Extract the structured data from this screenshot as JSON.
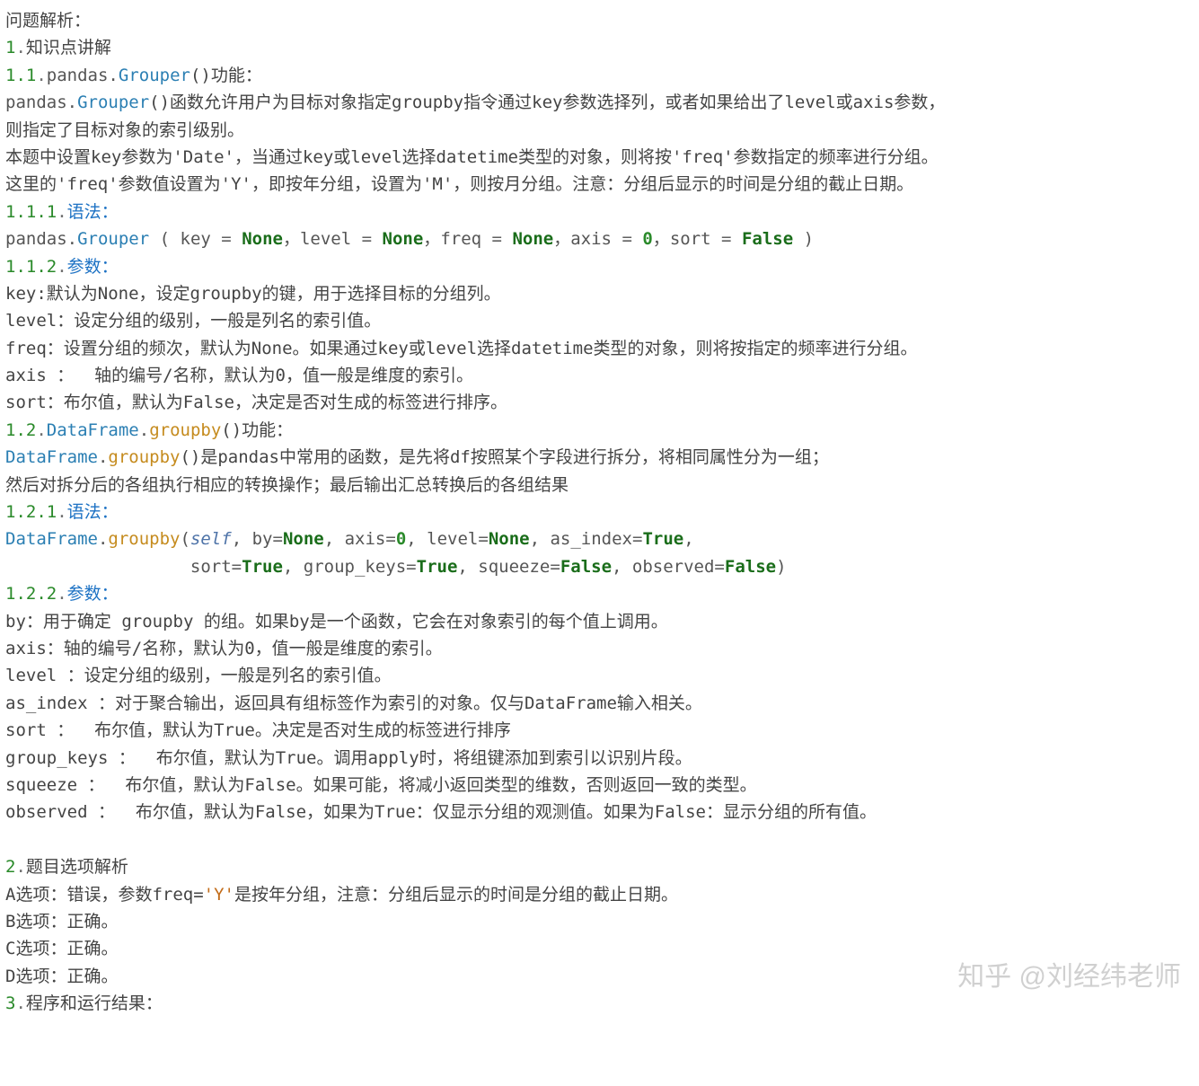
{
  "l00": "问题解析：",
  "s1num": "1",
  "s1dot": ".",
  "s1txt": "知识点讲解",
  "s11num": "1.1",
  "s11dot": ".",
  "s11_pandas": "pandas",
  "s11_Grouper": "Grouper",
  "s11_suffix": "()功能：",
  "p1a_pandas": "pandas",
  "p1a_Grouper": "Grouper",
  "p1a_rest": "()函数允许用户为目标对象指定groupby指令通过key参数选择列，或者如果给出了level或axis参数，",
  "p1b": "则指定了目标对象的索引级别。",
  "p2": "本题中设置key参数为'Date'，当通过key或level选择datetime类型的对象，则将按'freq'参数指定的频率进行分组。",
  "p3": "这里的'freq'参数值设置为'Y'，即按年分组，设置为'M'，则按月分组。注意：分组后显示的时间是分组的截止日期。",
  "s111num": "1.1.1",
  "s111dot": ".",
  "s111txt": "语法：",
  "sig1_pandas": "pandas",
  "sig1_Grouper": "Grouper",
  "sig1_key": "key",
  "sig1_None": "None",
  "sig1_level": "level",
  "sig1_freq": "freq",
  "sig1_axis": "axis",
  "sig1_zero": "0",
  "sig1_sort": "sort",
  "sig1_False": "False",
  "s112num": "1.1.2",
  "s112dot": ".",
  "s112txt": "参数：",
  "par_key": "key:默认为None，设定groupby的键，用于选择目标的分组列。",
  "par_level": "level：设定分组的级别，一般是列名的索引值。",
  "par_freq": "freq：设置分组的频次，默认为None。如果通过key或level选择datetime类型的对象，则将按指定的频率进行分组。",
  "par_axis": "axis ：  轴的编号/名称，默认为0，值一般是维度的索引。",
  "par_sort": "sort：布尔值，默认为False，决定是否对生成的标签进行排序。",
  "s12num": "1.2",
  "s12dot": ".",
  "s12_DF": "DataFrame",
  "s12_gb": "groupby",
  "s12_suffix": "()功能：",
  "p4_DF": "DataFrame",
  "p4_gb": "groupby",
  "p4_rest": "()是pandas中常用的函数，是先将df按照某个字段进行拆分，将相同属性分为一组；",
  "p5": "然后对拆分后的各组执行相应的转换操作；最后输出汇总转换后的各组结果",
  "s121num": "1.2.1",
  "s121dot": ".",
  "s121txt": "语法：",
  "sig2_DF": "DataFrame",
  "sig2_gb": "groupby",
  "sig2_self": "self",
  "sig2_by": "by",
  "sig2_None": "None",
  "sig2_axis": "axis",
  "sig2_zero": "0",
  "sig2_level": "level",
  "sig2_asidx": "as_index",
  "sig2_True": "True",
  "sig2_sort": "sort",
  "sig2_gk": "group_keys",
  "sig2_sq": "squeeze",
  "sig2_False": "False",
  "sig2_obs": "observed",
  "s122num": "1.2.2",
  "s122dot": ".",
  "s122txt": "参数：",
  "par2_by": "by：用于确定 groupby 的组。如果by是一个函数，它会在对象索引的每个值上调用。",
  "par2_axis": "axis：轴的编号/名称，默认为0，值一般是维度的索引。",
  "par2_level": "level ：设定分组的级别，一般是列名的索引值。",
  "par2_asidx": "as_index ：对于聚合输出，返回具有组标签作为索引的对象。仅与DataFrame输入相关。",
  "par2_sort": "sort ：  布尔值，默认为True。决定是否对生成的标签进行排序",
  "par2_gk": "group_keys ：  布尔值，默认为True。调用apply时，将组键添加到索引以识别片段。",
  "par2_sq": "squeeze ：  布尔值，默认为False。如果可能，将减小返回类型的维数，否则返回一致的类型。",
  "par2_obs": "observed ：  布尔值，默认为False，如果为True：仅显示分组的观测值。如果为False：显示分组的所有值。",
  "s2num": "2",
  "s2dot": ".",
  "s2txt": "题目选项解析",
  "optA_pre": "A选项：错误，参数freq=",
  "optA_Y": "'Y'",
  "optA_post": "是按年分组，注意：分组后显示的时间是分组的截止日期。",
  "optB": "B选项：正确。",
  "optC": "C选项：正确。",
  "optD": "D选项：正确。",
  "s3num": "3",
  "s3dot": ".",
  "s3txt": "程序和运行结果：",
  "wm_prefix": "知乎 ",
  "wm_at": "@",
  "wm_name": "刘经纬老师"
}
